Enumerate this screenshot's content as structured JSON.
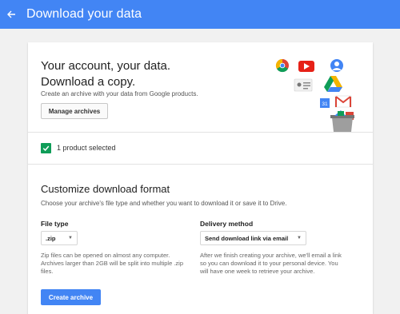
{
  "header": {
    "title": "Download your data",
    "back_icon": "arrow-back-icon",
    "bg_color": "#4285f4"
  },
  "hero": {
    "title_line1": "Your account, your data.",
    "title_line2": "Download a copy.",
    "subtitle": "Create an archive with your data from Google products.",
    "manage_label": "Manage archives",
    "icons": [
      "chrome-icon",
      "youtube-icon",
      "profile-icon",
      "contacts-icon",
      "drive-icon",
      "calendar-icon",
      "gmail-icon",
      "google-plus-icon",
      "box-icon"
    ],
    "calendar_day": "31"
  },
  "selection": {
    "label": "1 product selected",
    "checked": true,
    "check_color": "#0f9d58"
  },
  "format": {
    "title": "Customize download format",
    "subtitle": "Choose your archive's file type and whether you want to download it or save it to Drive.",
    "file_type": {
      "label": "File type",
      "selected": ".zip",
      "note_line1": "Zip files can be opened on almost any computer.",
      "note_line2": "Archives larger than 2GB will be split into multiple .zip",
      "note_line3": "files."
    },
    "delivery": {
      "label": "Delivery method",
      "selected": "Send download link via email",
      "note_line1": "After we finish creating your archive, we'll email a link",
      "note_line2": "so you can download it to your personal device. You",
      "note_line3": "will have one week to retrieve your archive."
    },
    "create_label": "Create archive"
  }
}
